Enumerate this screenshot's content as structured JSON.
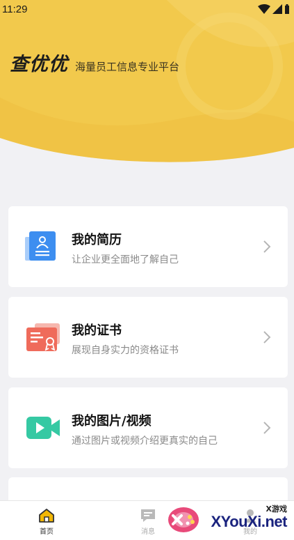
{
  "status_bar": {
    "time": "11:29"
  },
  "brand": {
    "name": "查优优",
    "slogan": "海量员工信息专业平台"
  },
  "colors": {
    "header": "#f2c94c",
    "header_dark": "#e8b638",
    "background": "#f1f1f4",
    "resume": "#3d8ef0",
    "certificate": "#ef6b5b",
    "media": "#35c9a3",
    "home_tab": "#f2b705"
  },
  "cards": [
    {
      "title": "我的简历",
      "desc": "让企业更全面地了解自己",
      "icon": "resume-icon"
    },
    {
      "title": "我的证书",
      "desc": "展现自身实力的资格证书",
      "icon": "certificate-icon"
    },
    {
      "title": "我的图片/视频",
      "desc": "通过图片或视频介绍更真实的自己",
      "icon": "video-icon"
    }
  ],
  "tabbar": {
    "home": "首页",
    "messages": "消息",
    "mine": "我的"
  },
  "watermark": {
    "small": "X游戏",
    "main": "XYouXi.net"
  }
}
